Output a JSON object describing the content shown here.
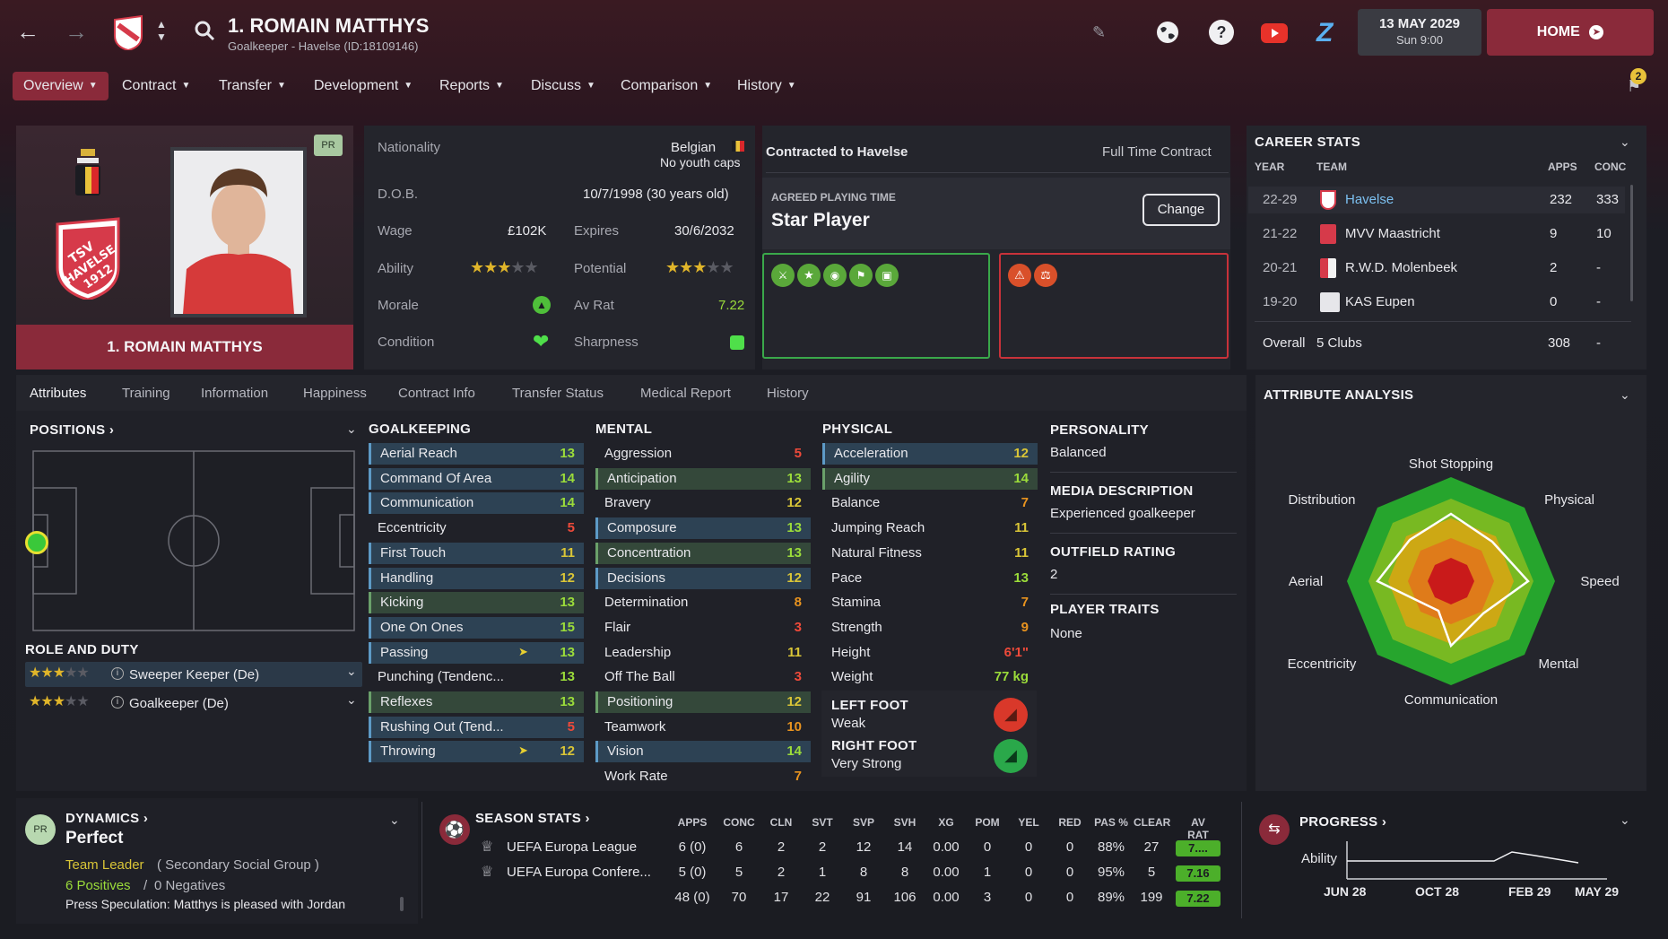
{
  "header": {
    "player_title": "1. ROMAIN MATTHYS",
    "player_subtitle": "Goalkeeper - Havelse (ID:18109146)",
    "date": "13 MAY 2029",
    "day_time": "Sun 9:00",
    "home_label": "HOME",
    "notification_count": "2"
  },
  "nav": {
    "items": [
      "Overview",
      "Contract",
      "Transfer",
      "Development",
      "Reports",
      "Discuss",
      "Comparison",
      "History"
    ]
  },
  "profile": {
    "name_banner": "1. ROMAIN MATTHYS",
    "pr_badge": "PR",
    "club_crest_text": "TSV HAVELSE 1912"
  },
  "info": {
    "nationality_label": "Nationality",
    "nationality_value": "Belgian",
    "youth_caps": "No youth caps",
    "dob_label": "D.O.B.",
    "dob_value": "10/7/1998 (30 years old)",
    "wage_label": "Wage",
    "wage_value": "£102K",
    "expires_label": "Expires",
    "expires_value": "30/6/2032",
    "ability_label": "Ability",
    "potential_label": "Potential",
    "ability_stars": 3,
    "potential_stars": 3,
    "morale_label": "Morale",
    "avrat_label": "Av Rat",
    "avrat_value": "7.22",
    "condition_label": "Condition",
    "sharpness_label": "Sharpness"
  },
  "contract": {
    "title": "Contracted to Havelse",
    "type": "Full Time Contract",
    "agreed_label": "AGREED PLAYING TIME",
    "agreed_value": "Star Player",
    "change_button": "Change"
  },
  "career": {
    "title": "CAREER STATS",
    "headers": [
      "YEAR",
      "TEAM",
      "APPS",
      "CONC"
    ],
    "rows": [
      {
        "year": "22-29",
        "team": "Havelse",
        "apps": "232",
        "conc": "333"
      },
      {
        "year": "21-22",
        "team": "MVV Maastricht",
        "apps": "9",
        "conc": "10"
      },
      {
        "year": "20-21",
        "team": "R.W.D. Molenbeek",
        "apps": "2",
        "conc": "-"
      },
      {
        "year": "19-20",
        "team": "KAS Eupen",
        "apps": "0",
        "conc": "-"
      }
    ],
    "overall_label": "Overall",
    "overall_clubs": "5 Clubs",
    "overall_apps": "308",
    "overall_conc": "-"
  },
  "tabs": [
    "Attributes",
    "Training",
    "Information",
    "Happiness",
    "Contract Info",
    "Transfer Status",
    "Medical Report",
    "History"
  ],
  "positions": {
    "title": "POSITIONS",
    "role_title": "ROLE AND DUTY",
    "roles": [
      {
        "label": "Sweeper Keeper (De)",
        "stars": 3
      },
      {
        "label": "Goalkeeper (De)",
        "stars": 3
      }
    ]
  },
  "goalkeeping": {
    "title": "GOALKEEPING",
    "attrs": [
      {
        "name": "Aerial Reach",
        "value": "13"
      },
      {
        "name": "Command Of Area",
        "value": "14"
      },
      {
        "name": "Communication",
        "value": "14"
      },
      {
        "name": "Eccentricity",
        "value": "5"
      },
      {
        "name": "First Touch",
        "value": "11"
      },
      {
        "name": "Handling",
        "value": "12"
      },
      {
        "name": "Kicking",
        "value": "13"
      },
      {
        "name": "One On Ones",
        "value": "15"
      },
      {
        "name": "Passing",
        "value": "13"
      },
      {
        "name": "Punching (Tendenc...",
        "value": "13"
      },
      {
        "name": "Reflexes",
        "value": "13"
      },
      {
        "name": "Rushing Out (Tend...",
        "value": "5"
      },
      {
        "name": "Throwing",
        "value": "12"
      }
    ]
  },
  "mental": {
    "title": "MENTAL",
    "attrs": [
      {
        "name": "Aggression",
        "value": "5"
      },
      {
        "name": "Anticipation",
        "value": "13"
      },
      {
        "name": "Bravery",
        "value": "12"
      },
      {
        "name": "Composure",
        "value": "13"
      },
      {
        "name": "Concentration",
        "value": "13"
      },
      {
        "name": "Decisions",
        "value": "12"
      },
      {
        "name": "Determination",
        "value": "8"
      },
      {
        "name": "Flair",
        "value": "3"
      },
      {
        "name": "Leadership",
        "value": "11"
      },
      {
        "name": "Off The Ball",
        "value": "3"
      },
      {
        "name": "Positioning",
        "value": "12"
      },
      {
        "name": "Teamwork",
        "value": "10"
      },
      {
        "name": "Vision",
        "value": "14"
      },
      {
        "name": "Work Rate",
        "value": "7"
      }
    ]
  },
  "physical": {
    "title": "PHYSICAL",
    "attrs": [
      {
        "name": "Acceleration",
        "value": "12"
      },
      {
        "name": "Agility",
        "value": "14"
      },
      {
        "name": "Balance",
        "value": "7"
      },
      {
        "name": "Jumping Reach",
        "value": "11"
      },
      {
        "name": "Natural Fitness",
        "value": "11"
      },
      {
        "name": "Pace",
        "value": "13"
      },
      {
        "name": "Stamina",
        "value": "7"
      },
      {
        "name": "Strength",
        "value": "9"
      },
      {
        "name": "Height",
        "value": "6'1\""
      },
      {
        "name": "Weight",
        "value": "77 kg"
      }
    ],
    "left_foot_label": "LEFT FOOT",
    "left_foot_value": "Weak",
    "right_foot_label": "RIGHT FOOT",
    "right_foot_value": "Very Strong"
  },
  "personality": {
    "personality_label": "PERSONALITY",
    "personality_value": "Balanced",
    "media_label": "MEDIA DESCRIPTION",
    "media_value": "Experienced goalkeeper",
    "outfield_label": "OUTFIELD RATING",
    "outfield_value": "2",
    "traits_label": "PLAYER TRAITS",
    "traits_value": "None"
  },
  "analysis": {
    "title": "ATTRIBUTE ANALYSIS",
    "axes": [
      "Shot Stopping",
      "Physical",
      "Speed",
      "Mental",
      "Communication",
      "Eccentricity",
      "Aerial",
      "Distribution"
    ]
  },
  "dynamics": {
    "title": "DYNAMICS",
    "value": "Perfect",
    "badge": "PR",
    "group_role": "Team Leader",
    "group_type": "( Secondary Social Group )",
    "positives": "6 Positives",
    "separator": "/",
    "negatives": "0 Negatives",
    "speculation": "Press Speculation: Matthys is pleased with Jordan"
  },
  "season": {
    "title": "SEASON STATS",
    "headers": [
      "APPS",
      "CONC",
      "CLN",
      "SVT",
      "SVP",
      "SVH",
      "XG",
      "POM",
      "YEL",
      "RED",
      "PAS %",
      "CLEAR",
      "AV RAT"
    ],
    "rows": [
      {
        "comp": "UEFA Europa League",
        "vals": [
          "6 (0)",
          "6",
          "2",
          "2",
          "12",
          "14",
          "0.00",
          "0",
          "0",
          "0",
          "88%",
          "27"
        ],
        "rat": "7...."
      },
      {
        "comp": "UEFA Europa Confere...",
        "vals": [
          "5 (0)",
          "5",
          "2",
          "1",
          "8",
          "8",
          "0.00",
          "1",
          "0",
          "0",
          "95%",
          "5"
        ],
        "rat": "7.16"
      },
      {
        "comp": "",
        "vals": [
          "48 (0)",
          "70",
          "17",
          "22",
          "91",
          "106",
          "0.00",
          "3",
          "0",
          "0",
          "89%",
          "199"
        ],
        "rat": "7.22"
      }
    ]
  },
  "progress": {
    "title": "PROGRESS",
    "ability_label": "Ability",
    "x_labels": [
      "JUN 28",
      "OCT 28",
      "FEB 29",
      "MAY 29"
    ]
  },
  "colors": {
    "accent": "#8a2a3a",
    "green_attr": "#9bdc3a",
    "yellow_attr": "#d9c537",
    "orange_attr": "#e8931f",
    "red_attr": "#ef4a3a"
  }
}
